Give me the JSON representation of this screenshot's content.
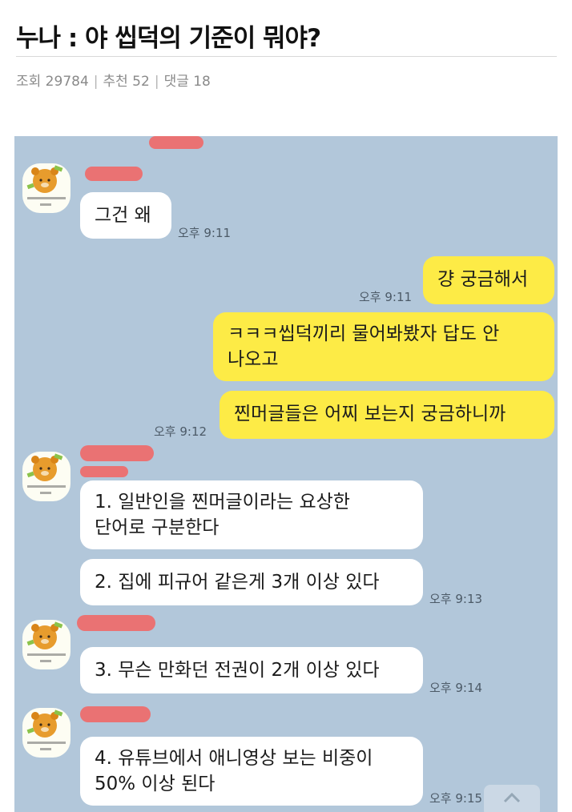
{
  "post": {
    "title": "누나 : 야 씹덕의 기준이 뭐야?",
    "meta": {
      "views_label": "조회 29784",
      "recommend_label": "추천 52",
      "comments_label": "댓글 18",
      "separator": "|"
    }
  },
  "chat": {
    "messages": [
      {
        "sender": "other",
        "text": "그건 왜",
        "time": "오후 9:11"
      },
      {
        "sender": "me",
        "text": "걍 궁금해서",
        "time": "오후 9:11"
      },
      {
        "sender": "me",
        "lines": [
          "ㅋㅋㅋ씹덕끼리 물어봐봤자 답도 안",
          "나오고"
        ]
      },
      {
        "sender": "me",
        "text": "찐머글들은 어찌 보는지 궁금하니까",
        "time": "오후 9:12"
      },
      {
        "sender": "other",
        "lines": [
          "1. 일반인을 찐머글이라는 요상한",
          "단어로 구분한다"
        ]
      },
      {
        "sender": "other",
        "text": "2. 집에 피규어 같은게 3개 이상 있다",
        "time": "오후 9:13"
      },
      {
        "sender": "other",
        "text": "3. 무슨 만화던 전권이 2개 이상 있다",
        "time": "오후 9:14"
      },
      {
        "sender": "other",
        "lines": [
          "4. 유튜브에서 애니영상 보는 비중이",
          "50% 이상 된다"
        ],
        "time": "오후 9:15"
      }
    ],
    "colors": {
      "background": "#b2c7da",
      "my_bubble": "#fdeb46",
      "their_bubble": "#ffffff",
      "redaction": "#ef6a6a"
    },
    "icons": {
      "avatar": "ryan-character-avatar",
      "scroll": "chevron-up-icon"
    }
  }
}
